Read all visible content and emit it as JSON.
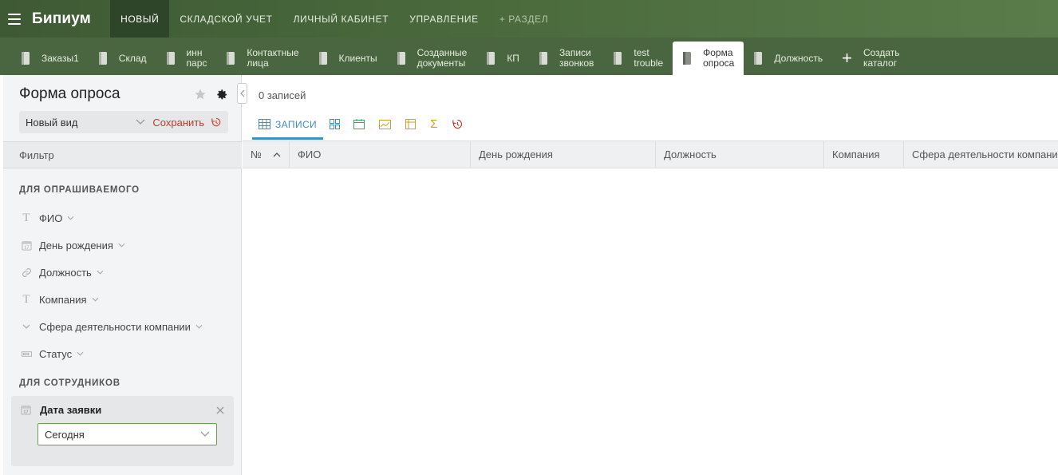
{
  "topbar": {
    "logo": "Бипиум",
    "nav": [
      {
        "label": "Новый",
        "active": true
      },
      {
        "label": "Складской учет"
      },
      {
        "label": "Личный кабинет"
      },
      {
        "label": "Управление"
      },
      {
        "label": "+ Раздел"
      }
    ]
  },
  "tabs": [
    {
      "label": "Заказы1"
    },
    {
      "label": "Склад"
    },
    {
      "label": "инн\nпарс"
    },
    {
      "label": "Контактные\nлица"
    },
    {
      "label": "Клиенты"
    },
    {
      "label": "Созданные\nдокументы"
    },
    {
      "label": "КП"
    },
    {
      "label": "Записи\nзвонков"
    },
    {
      "label": "test\ntrouble"
    },
    {
      "label": "Форма\nопроса",
      "active": true
    },
    {
      "label": "Должность"
    },
    {
      "label": "Создать\nкаталог"
    }
  ],
  "sidebar": {
    "title": "Форма опроса",
    "view_label": "Новый вид",
    "save_label": "Сохранить",
    "filter_label": "Фильтр",
    "group1": {
      "title": "Для опрашиваемого",
      "fields": [
        {
          "label": "ФИО",
          "icon": "text-icon"
        },
        {
          "label": "День рождения",
          "icon": "calendar-icon"
        },
        {
          "label": "Должность",
          "icon": "link-icon"
        },
        {
          "label": "Компания",
          "icon": "text-icon"
        },
        {
          "label": "Сфера деятельности компании",
          "icon": "dropdown-icon"
        },
        {
          "label": "Статус",
          "icon": "progress-icon"
        }
      ]
    },
    "group2": {
      "title": "Для сотрудников",
      "active_filter": {
        "label": "Дата заявки",
        "value": "Сегодня"
      }
    }
  },
  "main": {
    "records_count": "0 записей",
    "views": [
      {
        "label": "Записи",
        "icon": "table-icon",
        "active": true,
        "color": "#3b8fc2"
      },
      {
        "icon": "cards-icon",
        "color": "#3b8fc2"
      },
      {
        "icon": "calendar-icon",
        "color": "#3aa75a"
      },
      {
        "icon": "chart-icon",
        "color": "#c9a227"
      },
      {
        "icon": "pivot-icon",
        "color": "#c9a227"
      },
      {
        "icon": "sigma-icon",
        "color": "#c9a227"
      },
      {
        "icon": "history-icon",
        "color": "#c0392b"
      }
    ],
    "columns": [
      {
        "label": "№"
      },
      {
        "label": "ФИО"
      },
      {
        "label": "День рождения"
      },
      {
        "label": "Должность"
      },
      {
        "label": "Компания"
      },
      {
        "label": "Сфера деятельности компании"
      }
    ]
  },
  "colors": {
    "topbar": "#4a6a3c",
    "accent_blue": "#3b8fc2",
    "save_red": "#c0392b"
  }
}
